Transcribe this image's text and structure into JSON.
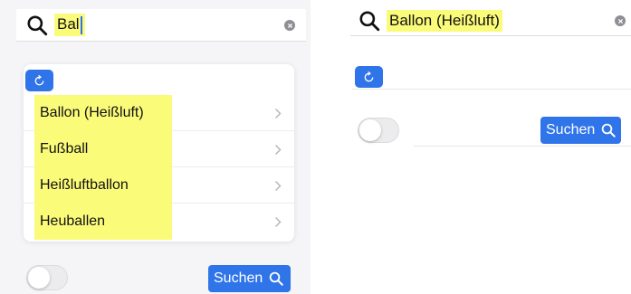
{
  "colors": {
    "accent": "#2f74e8",
    "highlight": "#fbfb7a",
    "panel_bg": "#f5f5f7"
  },
  "left": {
    "search": {
      "query": "Bal",
      "icon": "search-icon",
      "clear_icon": "clear-icon"
    },
    "refresh_icon": "refresh-icon",
    "results": [
      {
        "label": "Ballon (Heißluft)"
      },
      {
        "label": "Fußball"
      },
      {
        "label": "Heißluftballon"
      },
      {
        "label": "Heuballen"
      }
    ],
    "toggle": {
      "on": false
    },
    "search_button": {
      "label": "Suchen"
    }
  },
  "right": {
    "search": {
      "query": "Ballon (Heißluft)",
      "icon": "search-icon",
      "clear_icon": "clear-icon"
    },
    "refresh_icon": "refresh-icon",
    "toggle": {
      "on": false
    },
    "search_button": {
      "label": "Suchen"
    }
  }
}
